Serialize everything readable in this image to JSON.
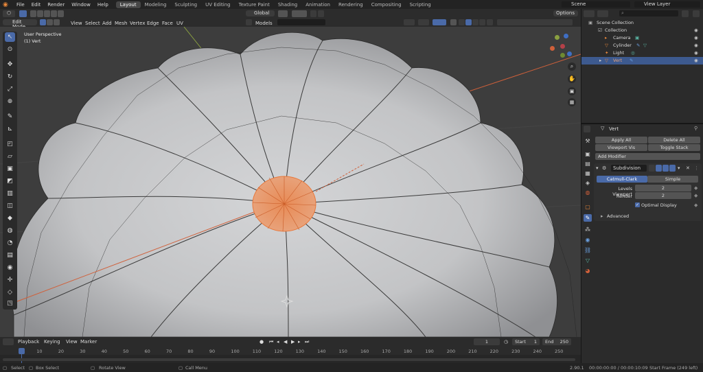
{
  "topbar": {
    "menus": [
      "File",
      "Edit",
      "Render",
      "Window",
      "Help"
    ],
    "workspaces": [
      "Layout",
      "Modeling",
      "Sculpting",
      "UV Editing",
      "Texture Paint",
      "Shading",
      "Animation",
      "Rendering",
      "Compositing",
      "Scripting"
    ],
    "active_workspace": "Layout",
    "scene_label": "Scene",
    "view_layer_label": "View Layer"
  },
  "viewport_header": {
    "mode": "Edit Mode",
    "menus": [
      "View",
      "Select",
      "Add",
      "Mesh",
      "Vertex",
      "Edge",
      "Face",
      "UV"
    ],
    "transform_orientation": "Global",
    "snap_target": "Models",
    "options_label": "Options"
  },
  "viewport": {
    "perspective_label": "User Perspective",
    "selection_label": "(1) Vert"
  },
  "outliner": {
    "scene_collection": "Scene Collection",
    "items": [
      {
        "label": "Collection",
        "indent": 1,
        "icon": "collection-icon"
      },
      {
        "label": "Camera",
        "indent": 2,
        "icon": "camera-icon"
      },
      {
        "label": "Cylinder",
        "indent": 2,
        "icon": "mesh-icon"
      },
      {
        "label": "Light",
        "indent": 2,
        "icon": "light-icon"
      },
      {
        "label": "Vert",
        "indent": 2,
        "icon": "mesh-icon",
        "selected": true
      }
    ]
  },
  "properties": {
    "object_name": "Vert",
    "apply_all": "Apply All",
    "delete_all": "Delete All",
    "viewport_vis": "Viewport Vis",
    "toggle_stack": "Toggle Stack",
    "add_modifier": "Add Modifier",
    "modifier_name": "Subdivision",
    "catmull_clark": "Catmull-Clark",
    "simple": "Simple",
    "levels_viewport_label": "Levels Viewport",
    "levels_viewport_value": "2",
    "render_label": "Render",
    "render_value": "2",
    "optimal_display": "Optimal Display",
    "advanced": "Advanced"
  },
  "timeline": {
    "menus": [
      "Playback",
      "Keying",
      "View",
      "Marker"
    ],
    "current_frame": "1",
    "start_label": "Start",
    "start_value": "1",
    "end_label": "End",
    "end_value": "250",
    "ticks": [
      "1",
      "10",
      "20",
      "30",
      "40",
      "50",
      "60",
      "70",
      "80",
      "90",
      "100",
      "110",
      "120",
      "130",
      "140",
      "150",
      "160",
      "170",
      "180",
      "190",
      "200",
      "210",
      "220",
      "230",
      "240",
      "250"
    ],
    "tick_values": [
      1,
      10,
      20,
      30,
      40,
      50,
      60,
      70,
      80,
      90,
      100,
      110,
      120,
      130,
      140,
      150,
      160,
      170,
      180,
      190,
      200,
      210,
      220,
      230,
      240,
      250
    ]
  },
  "statusbar": {
    "select": "Select",
    "box_select": "Box Select",
    "rotate_view": "Rotate View",
    "call_menu": "Call Menu",
    "version": "2.90.1",
    "timecode": "00:00:00:00 / 00:00:10:09",
    "start_frame": "Start Frame (249 left)"
  },
  "colors": {
    "accent": "#4a6aa8",
    "selection_orange": "#e8773a",
    "x_axis": "#d0603a",
    "y_axis": "#8aa040"
  }
}
